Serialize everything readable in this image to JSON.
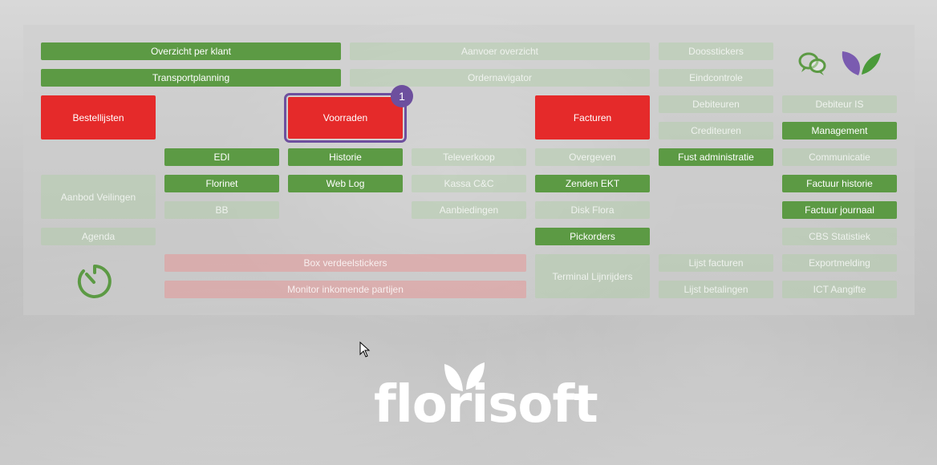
{
  "tiles": {
    "overzicht_per_klant": "Overzicht per klant",
    "transportplanning": "Transportplanning",
    "aanvoer_overzicht": "Aanvoer overzicht",
    "orderavigator": "Ordernavigator",
    "doosstickers": "Doosstickers",
    "eindcontrole": "Eindcontrole",
    "bestellijsten": "Bestellijsten",
    "voorraden": "Voorraden",
    "facturen": "Facturen",
    "debiteuren": "Debiteuren",
    "debiteur_is": "Debiteur IS",
    "crediteuren": "Crediteuren",
    "management": "Management",
    "edi": "EDI",
    "historie": "Historie",
    "televerkoop": "Televerkoop",
    "overgeven": "Overgeven",
    "fust_administratie": "Fust administratie",
    "communicatie": "Communicatie",
    "aanbod_veilingen": "Aanbod Veilingen",
    "florinet": "Florinet",
    "web_log": "Web Log",
    "kassa_cc": "Kassa C&C",
    "zenden_ekt": "Zenden EKT",
    "factuur_historie": "Factuur historie",
    "bb": "BB",
    "aanbiedingen": "Aanbiedingen",
    "disk_flora": "Disk Flora",
    "factuur_journaal": "Factuur journaal",
    "agenda": "Agenda",
    "pickorders": "Pickorders",
    "cbs_statistiek": "CBS Statistiek",
    "box_verdeelstickers": "Box verdeelstickers",
    "terminal_lijnrijders": "Terminal Lijnrijders",
    "lijst_facturen": "Lijst facturen",
    "exportmelding": "Exportmelding",
    "monitor_inkomende_partijen": "Monitor inkomende partijen",
    "lijst_betalingen": "Lijst betalingen",
    "ict_aangifte": "ICT Aangifte"
  },
  "badge_count": "1",
  "logo": {
    "text": "florisoft"
  },
  "icons": {
    "chat": "chat-bubbles-icon",
    "leaf": "purple-green-leaf-logo-icon",
    "timer": "timer-dial-icon",
    "cursor": "mouse-pointer-icon"
  },
  "colors": {
    "green": "#5c9a44",
    "red": "#e52a2a",
    "purple": "#6d4f9e"
  }
}
